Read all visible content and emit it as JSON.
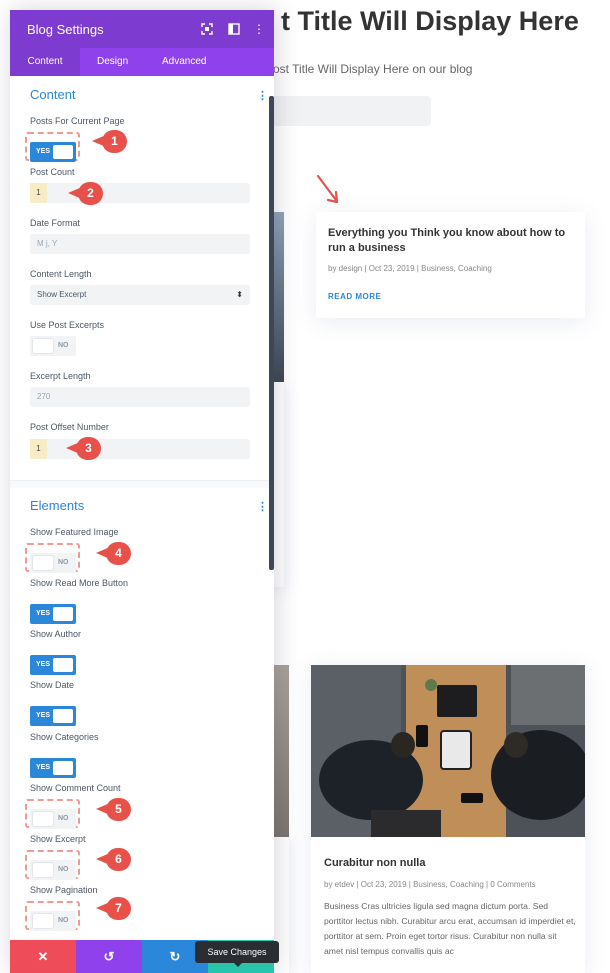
{
  "page": {
    "title": "t Title Will Display Here",
    "subtitle": "ost Title Will Display Here on our blog",
    "posts": [
      {
        "title": "Everything you Think you know about how to run a business",
        "meta": "by design | Oct 23, 2019 | Business, Coaching",
        "read_more": "READ MORE"
      },
      {
        "title": "Curabitur non nulla",
        "meta": "by etdev | Oct 23, 2019 | Business, Coaching | 0 Comments",
        "excerpt": "Business Cras ultricies ligula sed magna dictum porta. Sed porttitor lectus nibh. Curabitur arcu erat, accumsan id imperdiet et, porttitor at sem. Proin eget tortor risus. Curabitur non nulla sit amet nisl tempus convallis quis ac"
      }
    ]
  },
  "panel": {
    "title": "Blog Settings",
    "tabs": [
      "Content",
      "Design",
      "Advanced"
    ],
    "active_tab": "Content",
    "accent_color": "#7e3bd0",
    "tab_color": "#8f42ec",
    "toggle_on_color": "#2b87da",
    "content_section": {
      "heading": "Content",
      "posts_for_current_page": {
        "label": "Posts For Current Page",
        "value": "YES"
      },
      "post_count": {
        "label": "Post Count",
        "value": "1"
      },
      "date_format": {
        "label": "Date Format",
        "placeholder": "M j, Y"
      },
      "content_length": {
        "label": "Content Length",
        "value": "Show Excerpt"
      },
      "use_post_excerpts": {
        "label": "Use Post Excerpts",
        "value": "NO"
      },
      "excerpt_length": {
        "label": "Excerpt Length",
        "placeholder": "270"
      },
      "post_offset_number": {
        "label": "Post Offset Number",
        "value": "1"
      }
    },
    "elements_section": {
      "heading": "Elements",
      "show_featured_image": {
        "label": "Show Featured Image",
        "value": "NO"
      },
      "show_read_more_button": {
        "label": "Show Read More Button",
        "value": "YES"
      },
      "show_author": {
        "label": "Show Author",
        "value": "YES"
      },
      "show_date": {
        "label": "Show Date",
        "value": "YES"
      },
      "show_categories": {
        "label": "Show Categories",
        "value": "YES"
      },
      "show_comment_count": {
        "label": "Show Comment Count",
        "value": "NO"
      },
      "show_excerpt": {
        "label": "Show Excerpt",
        "value": "NO"
      },
      "show_pagination": {
        "label": "Show Pagination",
        "value": "NO"
      }
    },
    "footer": {
      "cancel_icon": "close-icon",
      "undo_icon": "undo-icon",
      "redo_icon": "redo-icon",
      "save_tooltip": "Save Changes",
      "cancel_color": "#ef4c5a",
      "undo_color": "#8f42ec",
      "redo_color": "#2b87da",
      "save_color": "#29c4a9"
    }
  },
  "annotations": {
    "callouts": [
      "1",
      "2",
      "3",
      "4",
      "5",
      "6",
      "7"
    ],
    "callout_color": "#e8514a"
  }
}
